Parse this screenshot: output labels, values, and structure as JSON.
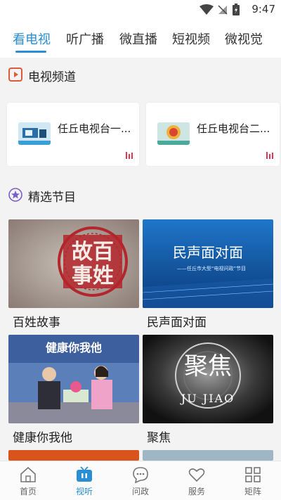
{
  "status_bar": {
    "time": "9:47"
  },
  "tabs": [
    {
      "label": "看电视",
      "active": true
    },
    {
      "label": "听广播"
    },
    {
      "label": "微直播"
    },
    {
      "label": "短视频"
    },
    {
      "label": "微视觉"
    }
  ],
  "tv_section": {
    "title": "电视频道",
    "channels": [
      {
        "name": "任丘电视台一..."
      },
      {
        "name": "任丘电视台二..."
      }
    ]
  },
  "programs_section": {
    "title": "精选节目",
    "items": [
      {
        "name": "百姓故事",
        "thumb_text": "故百\n事姓"
      },
      {
        "name": "民声面对面",
        "thumb_text": "民声面对面",
        "thumb_subtext": "——任丘市大型“电视问政”节目"
      },
      {
        "name": "健康你我他",
        "thumb_text": "健康你我他"
      },
      {
        "name": "聚焦",
        "thumb_text": "聚焦",
        "thumb_subtext": "JU JIAO"
      }
    ]
  },
  "bottom_nav": [
    {
      "label": "首页",
      "icon": "home-icon"
    },
    {
      "label": "视听",
      "icon": "tv-icon",
      "active": true
    },
    {
      "label": "问政",
      "icon": "chat-icon"
    },
    {
      "label": "服务",
      "icon": "heart-icon"
    },
    {
      "label": "矩阵",
      "icon": "grid-icon"
    }
  ],
  "colors": {
    "accent": "#2a8ed4",
    "live": "#e0394f",
    "section_bg": "#f3f3f3"
  }
}
